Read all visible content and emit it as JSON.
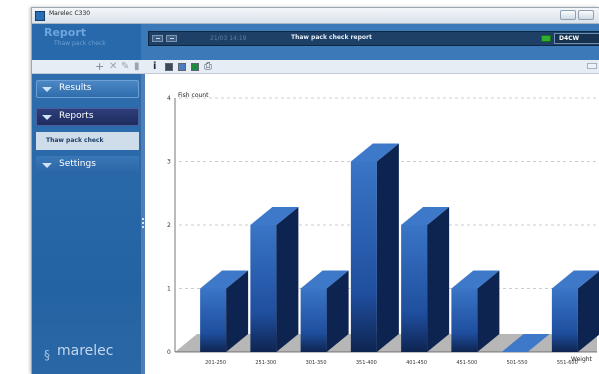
{
  "window": {
    "title": "Marelec C330",
    "controls": [
      "minimize",
      "maximize",
      "close"
    ]
  },
  "header": {
    "title": "Report",
    "subtitle": "Thaw pack check",
    "date_time": "21/03 14:19",
    "report_title": "Thaw pack check report",
    "device": "D4CW"
  },
  "toolbar": {
    "icons": [
      "add-icon",
      "delete-icon",
      "edit-icon",
      "trash-icon",
      "info-icon",
      "grid-icon",
      "bar-chart-icon",
      "excel-icon",
      "print-icon"
    ]
  },
  "sidebar": {
    "items": [
      {
        "label": "Results"
      },
      {
        "label": "Reports"
      },
      {
        "label": "Settings"
      }
    ],
    "subitems": [
      {
        "label": "Thaw pack check"
      }
    ],
    "logo": "marelec"
  },
  "colors": {
    "bar": "#1f4e9e",
    "bar_dark": "#0e2450",
    "bar_top": "#3d78c9",
    "sidebar": "#2868a8",
    "floor": "#b7b7b7"
  },
  "chart_data": {
    "type": "bar",
    "ylabel": "Fish count",
    "xlabel": "Weight",
    "ylim": [
      0,
      4
    ],
    "yticks": [
      0,
      1,
      2,
      3,
      4
    ],
    "grid": true,
    "categories": [
      "201-250",
      "251-300",
      "301-350",
      "351-400",
      "401-450",
      "451-500",
      "501-550",
      "551-600"
    ],
    "values": [
      1,
      2,
      1,
      3,
      2,
      1,
      0,
      1
    ]
  }
}
